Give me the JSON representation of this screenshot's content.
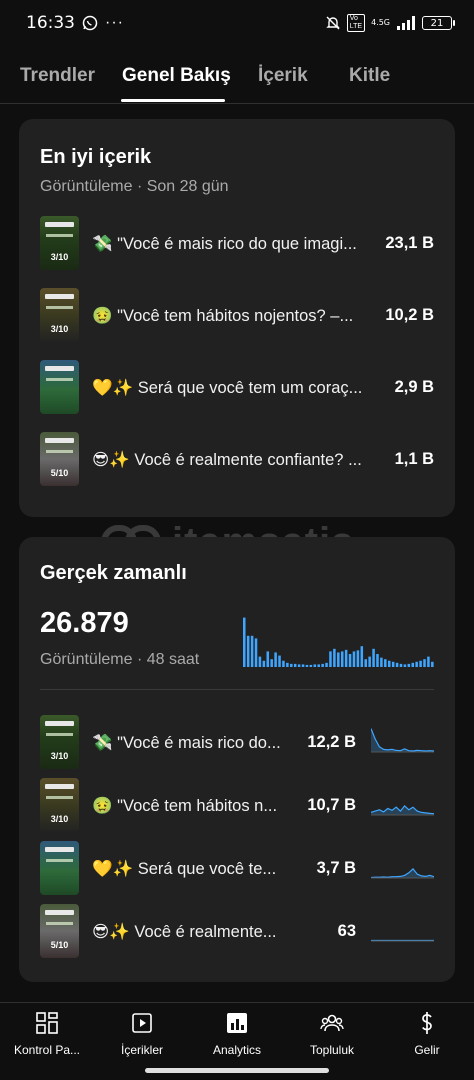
{
  "status_bar": {
    "time": "16:33",
    "network": "4.5G",
    "battery": "21"
  },
  "tabs": [
    {
      "label": "Trendler",
      "active": false
    },
    {
      "label": "Genel Bakış",
      "active": true
    },
    {
      "label": "İçerik",
      "active": false
    },
    {
      "label": "Kitle",
      "active": false
    }
  ],
  "top_content": {
    "title": "En iyi içerik",
    "subtitle": "Görüntüleme · Son 28 gün",
    "items": [
      {
        "emoji": "💸",
        "title": "\"Você é mais rico do que imagi...",
        "value": "23,1 B",
        "thumb_label": "3/10"
      },
      {
        "emoji": "🤢",
        "title": "\"Você tem hábitos nojentos? –...",
        "value": "10,2 B",
        "thumb_label": "3/10"
      },
      {
        "emoji": "💛✨",
        "title": "Será que você tem um coraç...",
        "value": "2,9 B",
        "thumb_label": ""
      },
      {
        "emoji": "😎✨",
        "title": "Você é realmente confiante? ...",
        "value": "1,1 B",
        "thumb_label": "5/10"
      }
    ]
  },
  "watermark": {
    "text": "itemsatis"
  },
  "realtime": {
    "title": "Gerçek zamanlı",
    "total": "26.879",
    "subtitle": "Görüntüleme · 48 saat",
    "accent_color": "#3ea6ff",
    "hourly_bars": [
      0.95,
      0.6,
      0.6,
      0.55,
      0.2,
      0.12,
      0.3,
      0.15,
      0.28,
      0.22,
      0.12,
      0.08,
      0.06,
      0.06,
      0.05,
      0.05,
      0.04,
      0.04,
      0.05,
      0.05,
      0.06,
      0.08,
      0.3,
      0.35,
      0.28,
      0.3,
      0.33,
      0.25,
      0.3,
      0.32,
      0.4,
      0.15,
      0.2,
      0.35,
      0.25,
      0.18,
      0.15,
      0.12,
      0.1,
      0.08,
      0.06,
      0.05,
      0.06,
      0.08,
      0.1,
      0.12,
      0.15,
      0.2,
      0.1
    ],
    "items": [
      {
        "emoji": "💸",
        "title": "\"Você é mais rico do...",
        "value": "12,2 B",
        "thumb_label": "3/10",
        "trend": [
          0.9,
          0.5,
          0.2,
          0.1,
          0.08,
          0.1,
          0.06,
          0.05,
          0.12,
          0.05,
          0.04,
          0.06,
          0.05,
          0.04,
          0.05,
          0.04
        ]
      },
      {
        "emoji": "🤢",
        "title": "\"Você tem hábitos n...",
        "value": "10,7 B",
        "thumb_label": "3/10",
        "trend": [
          0.1,
          0.15,
          0.2,
          0.12,
          0.25,
          0.18,
          0.3,
          0.15,
          0.35,
          0.2,
          0.3,
          0.15,
          0.1,
          0.08,
          0.06,
          0.05
        ]
      },
      {
        "emoji": "💛✨",
        "title": "Será que você te...",
        "value": "3,7 B",
        "thumb_label": "",
        "trend": [
          0.02,
          0.03,
          0.03,
          0.04,
          0.03,
          0.05,
          0.05,
          0.06,
          0.1,
          0.2,
          0.35,
          0.15,
          0.08,
          0.06,
          0.1,
          0.05
        ]
      },
      {
        "emoji": "😎✨",
        "title": "Você é realmente...",
        "value": "63",
        "thumb_label": "5/10",
        "trend": [
          0.02,
          0.02,
          0.02,
          0.02,
          0.02,
          0.02,
          0.02,
          0.02,
          0.02,
          0.02,
          0.02,
          0.02,
          0.02,
          0.02,
          0.02,
          0.02
        ]
      }
    ]
  },
  "bottom_nav": [
    {
      "label": "Kontrol Pa...",
      "icon": "dashboard-icon"
    },
    {
      "label": "İçerikler",
      "icon": "content-icon"
    },
    {
      "label": "Analytics",
      "icon": "analytics-icon",
      "active": true
    },
    {
      "label": "Topluluk",
      "icon": "community-icon"
    },
    {
      "label": "Gelir",
      "icon": "earn-icon"
    }
  ]
}
